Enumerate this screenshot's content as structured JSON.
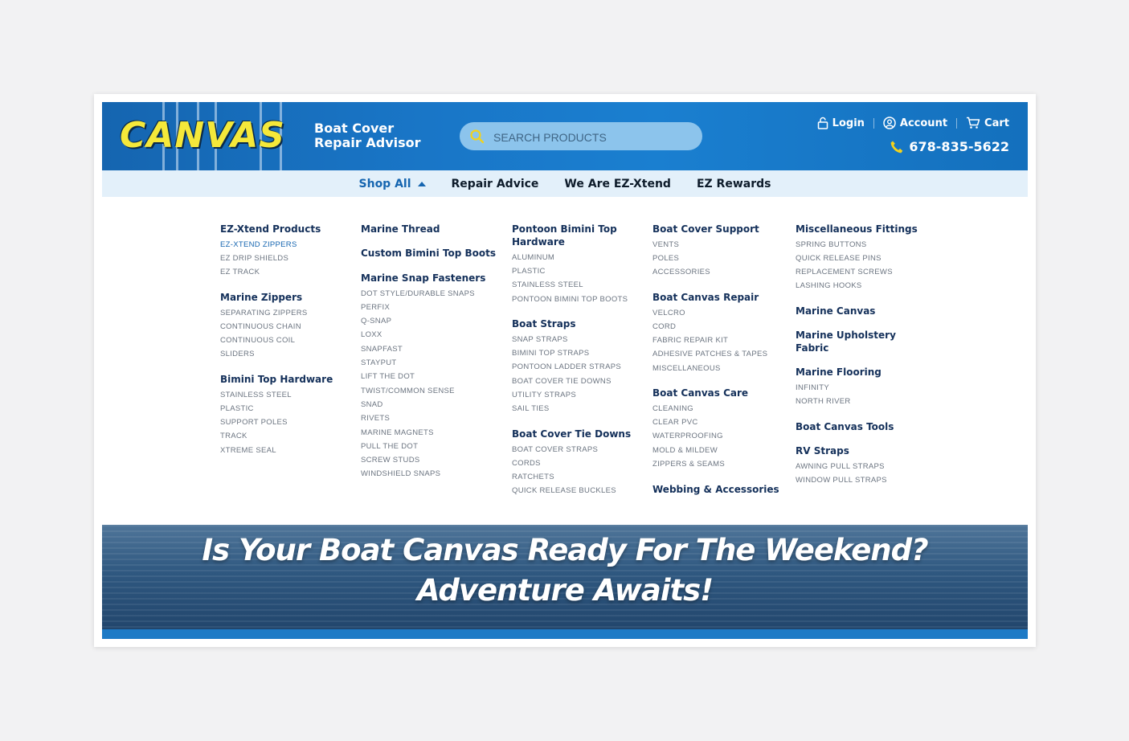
{
  "header": {
    "logo_text": "CANVAS",
    "tagline_line1": "Boat Cover",
    "tagline_line2": "Repair Advisor",
    "search_placeholder": "SEARCH PRODUCTS",
    "login": "Login",
    "account": "Account",
    "cart": "Cart",
    "phone": "678-835-5622"
  },
  "nav": {
    "items": [
      "Shop All",
      "Repair Advice",
      "We Are EZ-Xtend",
      "EZ Rewards"
    ]
  },
  "menu": {
    "col1": {
      "c1": "EZ-Xtend Products",
      "c1_items": [
        "EZ-XTEND ZIPPERS",
        "EZ DRIP SHIELDS",
        "EZ TRACK"
      ],
      "c2": "Marine Zippers",
      "c2_items": [
        "SEPARATING ZIPPERS",
        "CONTINUOUS CHAIN",
        "CONTINUOUS COIL",
        "SLIDERS"
      ],
      "c3": "Bimini Top Hardware",
      "c3_items": [
        "STAINLESS STEEL",
        "PLASTIC",
        "SUPPORT POLES",
        "TRACK",
        "XTREME SEAL"
      ]
    },
    "col2": {
      "c1": "Marine Thread",
      "c2": "Custom Bimini Top Boots",
      "c3": "Marine Snap Fasteners",
      "c3_items": [
        "DOT STYLE/DURABLE SNAPS",
        "PERFIX",
        "Q-SNAP",
        "LOXX",
        "SNAPFAST",
        "STAYPUT",
        "LIFT THE DOT",
        "TWIST/COMMON SENSE",
        "SNAD",
        "RIVETS",
        "MARINE MAGNETS",
        "PULL THE DOT",
        "SCREW STUDS",
        "WINDSHIELD SNAPS"
      ]
    },
    "col3": {
      "c1_line1": "Pontoon Bimini Top",
      "c1_line2": "Hardware",
      "c1_items": [
        "ALUMINUM",
        "PLASTIC",
        "STAINLESS STEEL",
        "PONTOON BIMINI TOP BOOTS"
      ],
      "c2": "Boat Straps",
      "c2_items": [
        "SNAP STRAPS",
        "BIMINI TOP STRAPS",
        "PONTOON LADDER STRAPS",
        "BOAT COVER TIE DOWNS",
        "UTILITY STRAPS",
        "SAIL TIES"
      ],
      "c3": "Boat Cover Tie Downs",
      "c3_items": [
        "BOAT COVER STRAPS",
        "CORDS",
        "RATCHETS",
        "QUICK RELEASE BUCKLES"
      ]
    },
    "col4": {
      "c1": "Boat Cover Support",
      "c1_items": [
        "VENTS",
        "POLES",
        "ACCESSORIES"
      ],
      "c2": "Boat Canvas Repair",
      "c2_items": [
        "VELCRO",
        "CORD",
        "FABRIC REPAIR KIT",
        "ADHESIVE PATCHES & TAPES",
        "MISCELLANEOUS"
      ],
      "c3": "Boat Canvas Care",
      "c3_items": [
        "CLEANING",
        "CLEAR PVC",
        "WATERPROOFING",
        "MOLD & MILDEW",
        "ZIPPERS & SEAMS"
      ],
      "c4": "Webbing & Accessories"
    },
    "col5": {
      "c1": "Miscellaneous Fittings",
      "c1_items": [
        "SPRING BUTTONS",
        "QUICK RELEASE PINS",
        "REPLACEMENT SCREWS",
        "LASHING HOOKS"
      ],
      "c2": "Marine Canvas",
      "c3_line1": "Marine Upholstery",
      "c3_line2": "Fabric",
      "c4": "Marine Flooring",
      "c4_items": [
        "INFINITY",
        "NORTH RIVER"
      ],
      "c5": "Boat Canvas Tools",
      "c6": "RV Straps",
      "c6_items": [
        "AWNING PULL STRAPS",
        "WINDOW PULL STRAPS"
      ]
    }
  },
  "banner": {
    "line1": "Is Your Boat Canvas Ready For The Weekend?",
    "line2": "Adventure Awaits!"
  },
  "colors": {
    "brand_blue": "#1976c7",
    "logo_yellow": "#f5e83a",
    "nav_bg": "#e3f0fa",
    "category_text": "#14305a"
  }
}
